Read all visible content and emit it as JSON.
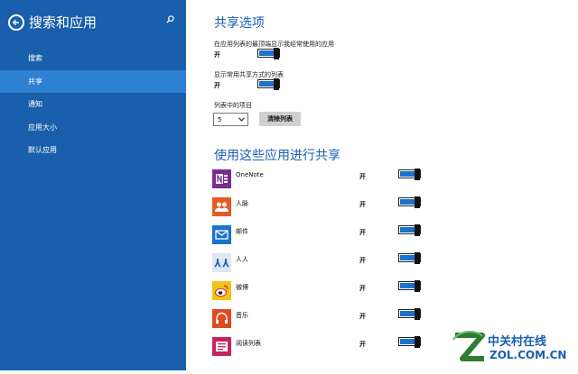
{
  "sidebar": {
    "title": "搜索和应用",
    "items": [
      {
        "label": "搜索"
      },
      {
        "label": "共享"
      },
      {
        "label": "通知"
      },
      {
        "label": "应用大小"
      },
      {
        "label": "默认应用"
      }
    ],
    "active_index": 1
  },
  "share_options": {
    "title": "共享选项",
    "frequent_apps_label": "在应用列表的最顶端显示我经常使用的应用",
    "frequent_apps_state": "开",
    "frequent_apps_on": true,
    "list_label": "显示常用共享方式的列表",
    "list_state": "开",
    "list_on": true,
    "items_label": "列表中的项目",
    "items_value": "5",
    "clear_button": "清除列表"
  },
  "share_apps": {
    "title": "使用这些应用进行共享",
    "apps": [
      {
        "name": "OneNote",
        "state": "开",
        "on": true,
        "icon": "onenote-icon",
        "color": "#7b2b8f"
      },
      {
        "name": "人脉",
        "state": "开",
        "on": true,
        "icon": "people-icon",
        "color": "#e35b24"
      },
      {
        "name": "邮件",
        "state": "开",
        "on": true,
        "icon": "mail-icon",
        "color": "#1a73cc"
      },
      {
        "name": "人人",
        "state": "开",
        "on": true,
        "icon": "renren-icon",
        "color": "#dfe6ee"
      },
      {
        "name": "微博",
        "state": "开",
        "on": true,
        "icon": "weibo-icon",
        "color": "#f0c318"
      },
      {
        "name": "音乐",
        "state": "开",
        "on": true,
        "icon": "music-icon",
        "color": "#e04a1f"
      },
      {
        "name": "阅读列表",
        "state": "开",
        "on": true,
        "icon": "reading-list-icon",
        "color": "#c4265a"
      }
    ]
  },
  "watermark": {
    "line1": "中关村在线",
    "line2": "ZOL.COM.CN"
  },
  "colors": {
    "sidebar_bg": "#1a5fab",
    "sidebar_active": "#2d80d2",
    "heading": "#1b5fb3",
    "toggle_fill": "#1a73cc"
  }
}
